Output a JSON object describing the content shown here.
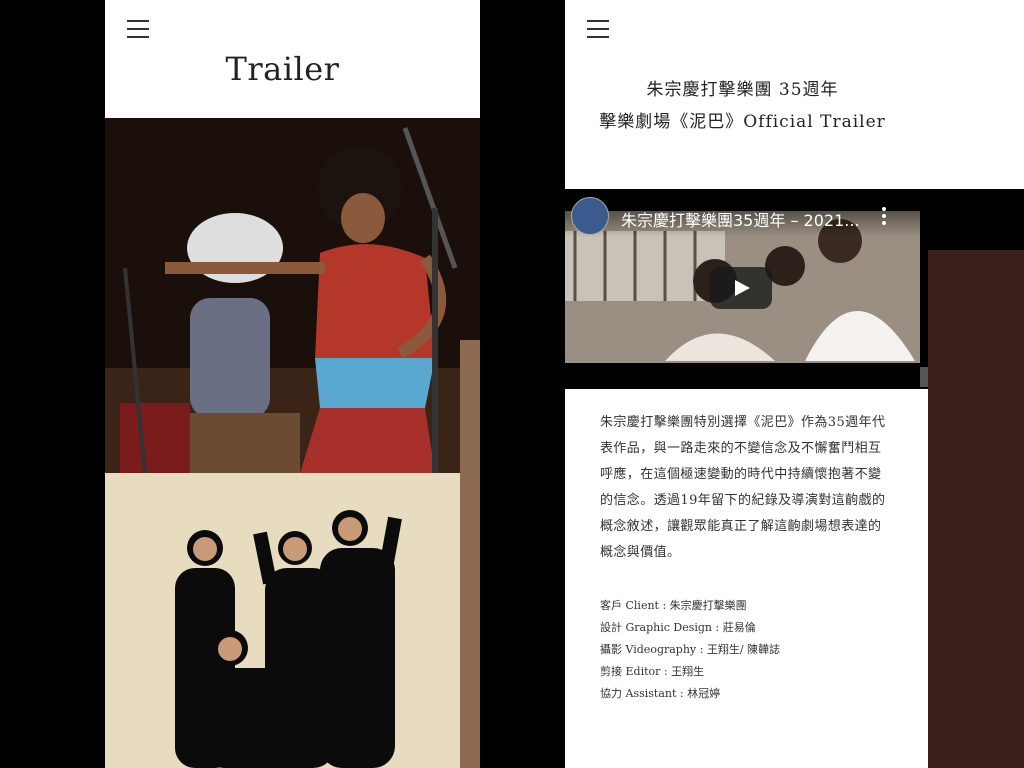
{
  "left_screen": {
    "menu_icon": "hamburger-icon",
    "title": "Trailer",
    "photos": [
      "performance-photo",
      "group-photo"
    ]
  },
  "right_screen": {
    "menu_icon": "hamburger-icon",
    "headline_line1": "朱宗慶打擊樂團 35週年",
    "headline_line2": "擊樂劇場《泥巴》Official Trailer",
    "video": {
      "title": "朱宗慶打擊樂團35週年 – 2021...",
      "play_icon": "play-icon",
      "more_icon": "kebab-menu-icon"
    },
    "description": "朱宗慶打擊樂團特別選擇《泥巴》作為35週年代表作品，與一路走來的不變信念及不懈奮鬥相互呼應，在這個極速變動的時代中持續懷抱著不變的信念。透過19年留下的紀錄及導演對這齣戲的概念敘述，讓觀眾能真正了解這齣劇場想表達的概念與價值。",
    "credits": [
      "客戶 Client : 朱宗慶打擊樂團",
      "設計 Graphic Design : 莊易倫",
      "攝影 Videography : 王翔生/ 陳韡誌",
      "剪接 Editor : 王翔生",
      "協力 Assistant : 林冠婷"
    ]
  }
}
